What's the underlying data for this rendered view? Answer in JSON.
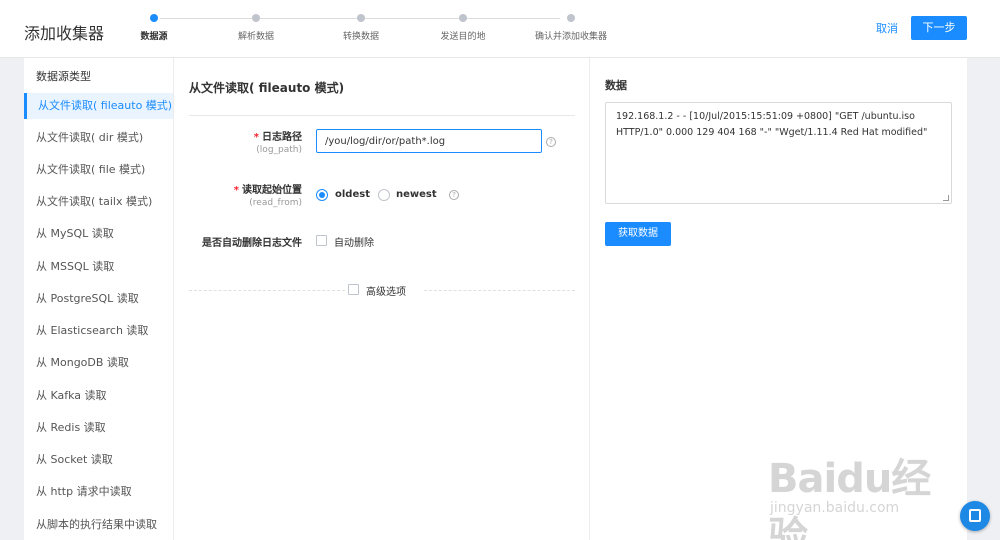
{
  "header": {
    "title": "添加收集器",
    "steps": [
      "数据源",
      "解析数据",
      "转换数据",
      "发送目的地",
      "确认并添加收集器"
    ],
    "cancel_label": "取消",
    "next_label": "下一步"
  },
  "sidebar": {
    "title": "数据源类型",
    "items": [
      "从文件读取( fileauto 模式)",
      "从文件读取( dir 模式)",
      "从文件读取( file 模式)",
      "从文件读取( tailx 模式)",
      "从 MySQL 读取",
      "从 MSSQL 读取",
      "从 PostgreSQL 读取",
      "从 Elasticsearch 读取",
      "从 MongoDB 读取",
      "从 Kafka 读取",
      "从 Redis 读取",
      "从 Socket 读取",
      "从 http 请求中读取",
      "从脚本的执行结果中读取"
    ]
  },
  "form": {
    "title": "从文件读取( fileauto 模式)",
    "log_path_label": "日志路径",
    "log_path_sub": "(log_path)",
    "log_path_value": "/you/log/dir/or/path*.log",
    "read_from_label": "读取起始位置",
    "read_from_sub": "(read_from)",
    "option_oldest": "oldest",
    "option_newest": "newest",
    "auto_delete_label": "是否自动删除日志文件",
    "auto_delete_option": "自动删除",
    "advanced_label": "高级选项",
    "help_glyph": "?"
  },
  "data_panel": {
    "title": "数据",
    "sample": "192.168.1.2 - - [10/Jul/2015:15:51:09 +0800] \"GET /ubuntu.iso HTTP/1.0\" 0.000 129 404 168 \"-\" \"Wget/1.11.4 Red Hat modified\"",
    "fetch_label": "获取数据"
  },
  "watermark": {
    "brand": "Baidu经验",
    "url": "jingyan.baidu.com"
  },
  "colors": {
    "accent": "#1a8cff",
    "required": "#f5222d"
  }
}
